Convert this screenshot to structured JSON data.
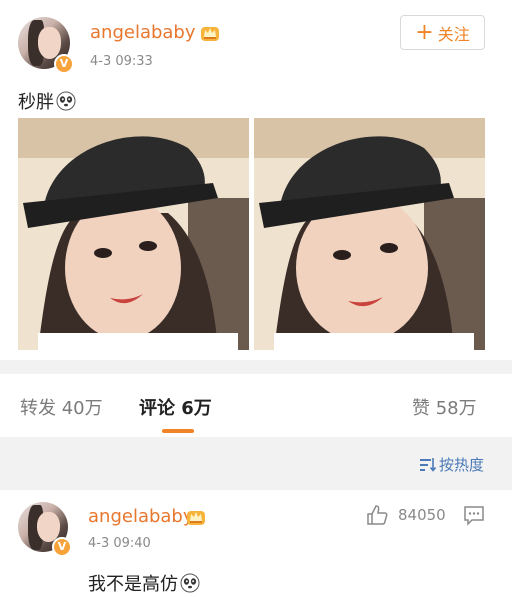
{
  "post": {
    "username": "angelababy",
    "timestamp": "4-3 09:33",
    "text": "秒胖",
    "follow": {
      "plus": "+",
      "label": "关注"
    },
    "verified_badge": "V",
    "crown_icon": "crown-icon",
    "photos": [
      "selfie-photo-left",
      "selfie-photo-right"
    ]
  },
  "tabs": {
    "repost": "转发 40万",
    "comments": "评论 6万",
    "likes": "赞 58万"
  },
  "sort": {
    "icon": "sort-list-icon",
    "label": "按热度"
  },
  "comment": {
    "username": "angelababy",
    "timestamp": "4-3 09:40",
    "text": "我不是高仿",
    "like_count": "84050",
    "verified_badge": "V",
    "like_icon": "thumbs-up-icon",
    "reply_icon": "comment-icon"
  },
  "colors": {
    "accent_orange": "#f08426",
    "username_orange": "#e8772e",
    "link_blue": "#4c7ab8",
    "muted_gray": "#8a8a8a",
    "background": "#f2f2f2"
  }
}
